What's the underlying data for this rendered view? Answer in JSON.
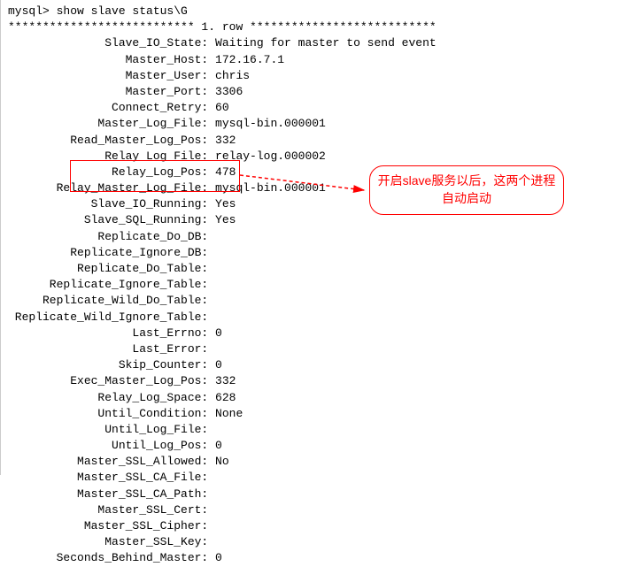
{
  "prompt": "mysql> show slave status\\G",
  "row_header": "*************************** 1. row ***************************",
  "fields": [
    {
      "label": "Slave_IO_State",
      "value": "Waiting for master to send event"
    },
    {
      "label": "Master_Host",
      "value": "172.16.7.1"
    },
    {
      "label": "Master_User",
      "value": "chris"
    },
    {
      "label": "Master_Port",
      "value": "3306"
    },
    {
      "label": "Connect_Retry",
      "value": "60"
    },
    {
      "label": "Master_Log_File",
      "value": "mysql-bin.000001"
    },
    {
      "label": "Read_Master_Log_Pos",
      "value": "332"
    },
    {
      "label": "Relay_Log_File",
      "value": "relay-log.000002"
    },
    {
      "label": "Relay_Log_Pos",
      "value": "478"
    },
    {
      "label": "Relay_Master_Log_File",
      "value": "mysql-bin.000001"
    },
    {
      "label": "Slave_IO_Running",
      "value": "Yes"
    },
    {
      "label": "Slave_SQL_Running",
      "value": "Yes"
    },
    {
      "label": "Replicate_Do_DB",
      "value": ""
    },
    {
      "label": "Replicate_Ignore_DB",
      "value": ""
    },
    {
      "label": "Replicate_Do_Table",
      "value": ""
    },
    {
      "label": "Replicate_Ignore_Table",
      "value": ""
    },
    {
      "label": "Replicate_Wild_Do_Table",
      "value": ""
    },
    {
      "label": "Replicate_Wild_Ignore_Table",
      "value": ""
    },
    {
      "label": "Last_Errno",
      "value": "0"
    },
    {
      "label": "Last_Error",
      "value": ""
    },
    {
      "label": "Skip_Counter",
      "value": "0"
    },
    {
      "label": "Exec_Master_Log_Pos",
      "value": "332"
    },
    {
      "label": "Relay_Log_Space",
      "value": "628"
    },
    {
      "label": "Until_Condition",
      "value": "None"
    },
    {
      "label": "Until_Log_File",
      "value": ""
    },
    {
      "label": "Until_Log_Pos",
      "value": "0"
    },
    {
      "label": "Master_SSL_Allowed",
      "value": "No"
    },
    {
      "label": "Master_SSL_CA_File",
      "value": ""
    },
    {
      "label": "Master_SSL_CA_Path",
      "value": ""
    },
    {
      "label": "Master_SSL_Cert",
      "value": ""
    },
    {
      "label": "Master_SSL_Cipher",
      "value": ""
    },
    {
      "label": "Master_SSL_Key",
      "value": ""
    },
    {
      "label": "Seconds_Behind_Master",
      "value": "0"
    }
  ],
  "annotation": {
    "line1": "开启slave服务以后，这两个进程",
    "line2": "自动启动"
  },
  "label_column_width": 28
}
